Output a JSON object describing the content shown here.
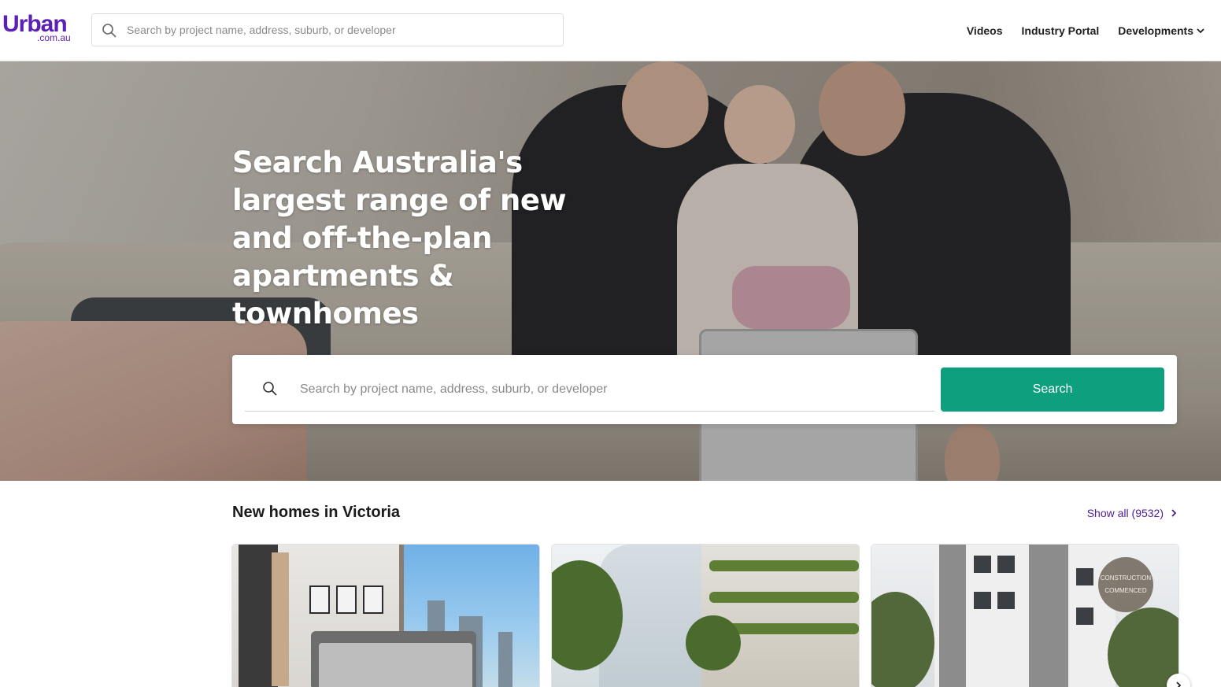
{
  "brand": {
    "logo_main": "Urban",
    "logo_sub": ".com.au",
    "accent_color": "#5b21b6"
  },
  "header": {
    "search_placeholder": "Search by project name, address, suburb, or developer",
    "nav": {
      "videos": "Videos",
      "industry_portal": "Industry Portal",
      "developments": "Developments"
    }
  },
  "hero": {
    "headline": "Search Australia's largest range of new and off-the-plan apartments & townhomes",
    "search_placeholder": "Search by project name, address, suburb, or developer",
    "search_button": "Search",
    "button_color": "#0e9f7e"
  },
  "listing": {
    "title": "New homes in Victoria",
    "show_all": "Show all (9532)",
    "cards": [
      {
        "image": "bedroom-interior-render"
      },
      {
        "image": "apartment-building-render"
      },
      {
        "image": "apartment-building-render",
        "badge_line1": "CONSTRUCTION",
        "badge_line2": "COMMENCED"
      }
    ]
  }
}
